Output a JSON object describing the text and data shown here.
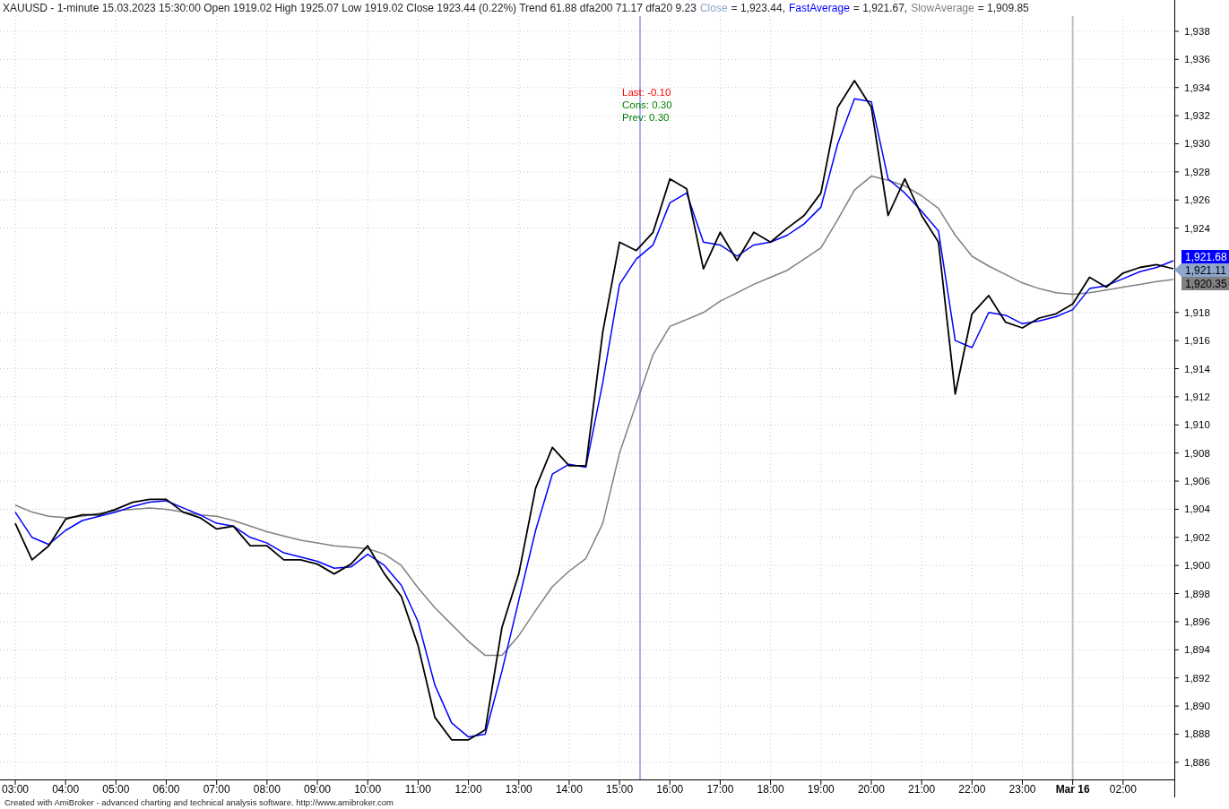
{
  "header": {
    "title": "XAUUSD - 1-minute 15.03.2023 15:30:00 Open 1919.02 High 1925.07 Low 1919.02 Close 1923.44 (0.22%) Trend 61.88 dfa200 71.17 dfa20 9.23",
    "legend": [
      {
        "label": "Close",
        "value": "= 1,923.44,",
        "color": "#8ea6cc"
      },
      {
        "label": "FastAverage",
        "value": "= 1,921.67,",
        "color": "#0000ff"
      },
      {
        "label": "SlowAverage",
        "value": "= 1,909.85",
        "color": "#808080"
      }
    ]
  },
  "chart": {
    "chart_data": {
      "type": "line",
      "categories": [
        "03:00",
        null,
        null,
        "04:00",
        null,
        null,
        "05:00",
        null,
        null,
        "06:00",
        null,
        null,
        "07:00",
        null,
        null,
        "08:00",
        null,
        null,
        "09:00",
        null,
        null,
        "10:00",
        null,
        null,
        "11:00",
        null,
        null,
        "12:00",
        null,
        null,
        "13:00",
        null,
        null,
        "14:00",
        null,
        null,
        "15:00",
        null,
        null,
        "16:00",
        null,
        null,
        "17:00",
        null,
        null,
        "18:00",
        null,
        null,
        "19:00",
        null,
        null,
        "20:00",
        null,
        null,
        "21:00",
        null,
        null,
        "22:00",
        null,
        null,
        "23:00",
        null,
        null,
        "Mar 16",
        null,
        null,
        "02:00",
        null,
        null,
        null
      ],
      "series": [
        {
          "color": "#000000",
          "values": [
            1903.0,
            1900.4,
            1901.4,
            1903.3,
            1903.6,
            1903.6,
            1904.0,
            1904.5,
            1904.7,
            1904.7,
            1903.8,
            1903.4,
            1902.6,
            1902.8,
            1901.4,
            1901.4,
            1900.4,
            1900.4,
            1900.1,
            1899.4,
            1900.1,
            1901.4,
            1899.4,
            1897.8,
            1894.3,
            1889.2,
            1887.6,
            1887.6,
            1888.3,
            1895.6,
            1899.4,
            1905.5,
            1908.4,
            1907.1,
            1907.1,
            1916.6,
            1923.0,
            1922.4,
            1923.7,
            1927.5,
            1926.8,
            1921.1,
            1923.7,
            1921.7,
            1923.7,
            1923.0,
            1924.0,
            1924.9,
            1926.5,
            1932.6,
            1934.5,
            1932.6,
            1924.9,
            1927.5,
            1924.9,
            1923.0,
            1912.2,
            1917.9,
            1919.2,
            1917.3,
            1916.9,
            1917.6,
            1917.9,
            1918.6,
            1920.5,
            1919.8,
            1920.8,
            1921.2,
            1921.4,
            1921.11
          ]
        },
        {
          "color": "#0000ff",
          "values": [
            1903.8,
            1902.0,
            1901.5,
            1902.5,
            1903.2,
            1903.5,
            1903.8,
            1904.2,
            1904.5,
            1904.6,
            1904.1,
            1903.6,
            1903.0,
            1902.8,
            1902.0,
            1901.6,
            1900.9,
            1900.6,
            1900.3,
            1899.8,
            1899.9,
            1900.8,
            1900.0,
            1898.6,
            1896.0,
            1891.5,
            1888.8,
            1887.8,
            1888.0,
            1892.5,
            1897.5,
            1902.5,
            1906.5,
            1907.2,
            1907.0,
            1913.0,
            1920.0,
            1921.8,
            1922.8,
            1925.8,
            1926.5,
            1923.0,
            1922.8,
            1922.0,
            1922.8,
            1923.0,
            1923.5,
            1924.3,
            1925.5,
            1930.0,
            1933.2,
            1933.0,
            1927.5,
            1926.5,
            1925.2,
            1923.8,
            1916.0,
            1915.5,
            1918.0,
            1917.8,
            1917.2,
            1917.4,
            1917.7,
            1918.2,
            1919.7,
            1919.9,
            1920.4,
            1920.9,
            1921.2,
            1921.68
          ]
        },
        {
          "color": "#808080",
          "values": [
            1904.3,
            1903.8,
            1903.5,
            1903.4,
            1903.5,
            1903.7,
            1903.9,
            1904.0,
            1904.1,
            1904.0,
            1903.8,
            1903.6,
            1903.5,
            1903.2,
            1902.8,
            1902.4,
            1902.1,
            1901.8,
            1901.6,
            1901.4,
            1901.3,
            1901.2,
            1900.8,
            1900.0,
            1898.4,
            1897.0,
            1895.8,
            1894.6,
            1893.6,
            1893.6,
            1895.0,
            1896.8,
            1898.5,
            1899.6,
            1900.5,
            1903.0,
            1908.0,
            1911.5,
            1915.0,
            1917.0,
            1917.5,
            1918.0,
            1918.8,
            1919.4,
            1920.0,
            1920.5,
            1921.0,
            1921.8,
            1922.6,
            1924.6,
            1926.7,
            1927.7,
            1927.4,
            1927.0,
            1926.3,
            1925.4,
            1923.5,
            1922.0,
            1921.3,
            1920.7,
            1920.1,
            1919.7,
            1919.4,
            1919.3,
            1919.4,
            1919.6,
            1919.8,
            1920.0,
            1920.2,
            1920.35
          ]
        }
      ],
      "ylim": [
        1884.78,
        1939.08
      ],
      "grid": true,
      "yticks": [
        {
          "value": 1886,
          "label": "1,886"
        },
        {
          "value": 1888,
          "label": "1,888"
        },
        {
          "value": 1890,
          "label": "1,890"
        },
        {
          "value": 1892,
          "label": "1,892"
        },
        {
          "value": 1894,
          "label": "1,894"
        },
        {
          "value": 1896,
          "label": "1,896"
        },
        {
          "value": 1898,
          "label": "1,898"
        },
        {
          "value": 1900,
          "label": "1,900"
        },
        {
          "value": 1902,
          "label": "1,902"
        },
        {
          "value": 1904,
          "label": "1,904"
        },
        {
          "value": 1906,
          "label": "1,906"
        },
        {
          "value": 1908,
          "label": "1,908"
        },
        {
          "value": 1910,
          "label": "1,910"
        },
        {
          "value": 1912,
          "label": "1,912"
        },
        {
          "value": 1914,
          "label": "1,914"
        },
        {
          "value": 1916,
          "label": "1,916"
        },
        {
          "value": 1918,
          "label": "1,918"
        },
        {
          "value": 1924,
          "label": "1,924"
        },
        {
          "value": 1926,
          "label": "1,926"
        },
        {
          "value": 1928,
          "label": "1,928"
        },
        {
          "value": 1930,
          "label": "1,930"
        },
        {
          "value": 1932,
          "label": "1,932"
        },
        {
          "value": 1934,
          "label": "1,934"
        },
        {
          "value": 1936,
          "label": "1,936"
        },
        {
          "value": 1938,
          "label": "1,938"
        }
      ],
      "ref_lines": [
        {
          "axis": "x",
          "value": "Mar 16",
          "color": "#c0c0c0"
        }
      ]
    },
    "cursor": {
      "color": "#a8aef8"
    },
    "notes": [
      {
        "text": "Last: -0.10",
        "color": "#ff0000"
      },
      {
        "text": "Cons: 0.30",
        "color": "#008000"
      },
      {
        "text": "Prev: 0.30",
        "color": "#008000"
      }
    ],
    "price_badges": [
      {
        "text": "1,921.68",
        "color": "#0000ff",
        "pointer": false
      },
      {
        "text": "1,921.11",
        "color": "#8ea6cc",
        "pointer": true
      },
      {
        "text": "1,920.35",
        "color": "#808080",
        "pointer": false
      }
    ]
  },
  "footer": "Created with AmiBroker - advanced charting and technical analysis software. http://www.amibroker.com"
}
